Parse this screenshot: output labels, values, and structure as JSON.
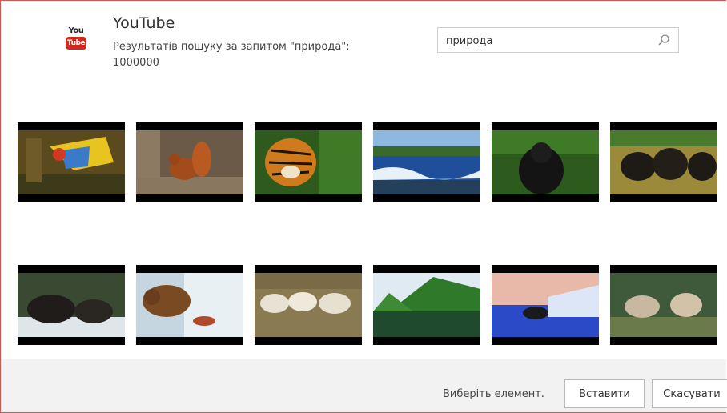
{
  "header": {
    "title": "YouTube",
    "subtitle": "Результатів пошуку за запитом \"природа\": 1000000"
  },
  "logo": {
    "top": "You",
    "bottom": "Tube"
  },
  "search": {
    "value": "природа",
    "icon": "search-icon"
  },
  "results": {
    "thumbnails": [
      {
        "subject": "parrot"
      },
      {
        "subject": "squirrel"
      },
      {
        "subject": "tiger"
      },
      {
        "subject": "coast"
      },
      {
        "subject": "gorilla"
      },
      {
        "subject": "buffalo"
      },
      {
        "subject": "boar"
      },
      {
        "subject": "bear"
      },
      {
        "subject": "sheep"
      },
      {
        "subject": "mountain-lake"
      },
      {
        "subject": "wolf"
      },
      {
        "subject": "goats"
      }
    ]
  },
  "footer": {
    "status": "Виберіть елемент.",
    "insert_label": "Вставити",
    "cancel_label": "Скасувати"
  },
  "colors": {
    "frame_border": "#d9534f",
    "logo_red": "#cc2b1d",
    "footer_bg": "#f2f2f2"
  }
}
